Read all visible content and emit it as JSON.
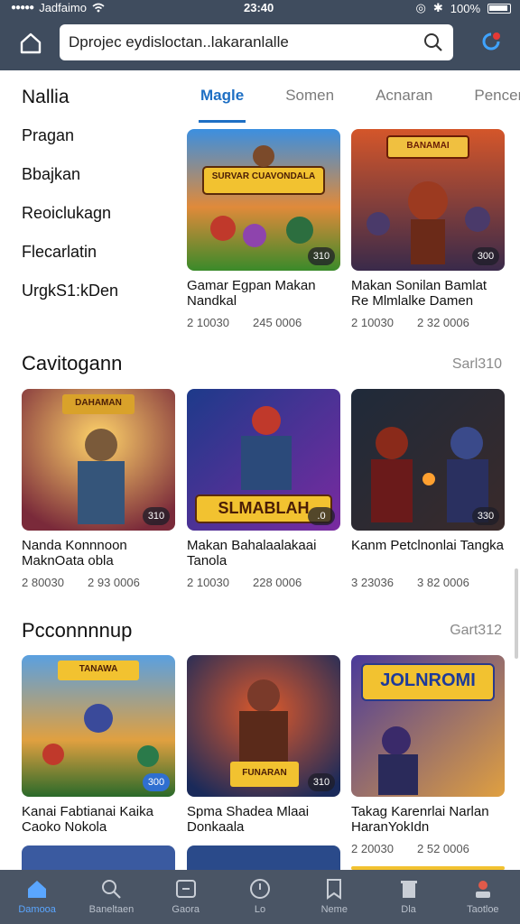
{
  "status_bar": {
    "carrier": "Jadfaimo",
    "time": "23:40",
    "battery": "100%"
  },
  "search": {
    "value": "Dprojec eydisloctan..lakaranlalle"
  },
  "left_menu": {
    "title": "Nallia",
    "items": [
      "Pragan",
      "Bbajkan",
      "Reoiclukagn",
      "Flecarlatin",
      "UrgkS1:kDen"
    ]
  },
  "tabs": [
    {
      "label": "Magle",
      "active": true
    },
    {
      "label": "Somen",
      "active": false
    },
    {
      "label": "Acnaran",
      "active": false
    },
    {
      "label": "Pencen",
      "active": false
    }
  ],
  "featured": [
    {
      "title": "Gamar Egpan Makan Nandkal",
      "badge": "310",
      "views": "2 10030",
      "plays": "245 0006",
      "banner": "SURVAR CUAVONDALA"
    },
    {
      "title": "Makan Sonilan Bamlat Re Mlmlalke Damen",
      "badge": "300",
      "views": "2 10030",
      "plays": "2 32 0006",
      "banner": "BANAMAI"
    }
  ],
  "sections": [
    {
      "title": "Cavitogann",
      "link": "Sarl310",
      "cards": [
        {
          "title": "Nanda Konnnoon MaknOata obla",
          "badge": "310",
          "views": "2 80030",
          "plays": "2 93 0006",
          "banner": "DAHAMAN"
        },
        {
          "title": "Makan Bahalaalakaai Tanola",
          "badge": ".0",
          "views": "2 10030",
          "plays": "228 0006",
          "banner": "SLMABLAH"
        },
        {
          "title": "Kanm Petclnonlai Tangka",
          "badge": "330",
          "views": "3 23036",
          "plays": "3 82 0006",
          "banner": ""
        }
      ]
    },
    {
      "title": "Pcconnnnup",
      "link": "Gart312",
      "cards": [
        {
          "title": "Kanai Fabtianai Kaika Caoko Nokola",
          "badge": "300",
          "views": "",
          "plays": "",
          "banner": "TANAWA"
        },
        {
          "title": "Spma Shadea Mlaai Donkaala",
          "badge": "310",
          "views": "",
          "plays": "",
          "banner": "FUNARAN"
        },
        {
          "title": "Takag Karenrlai Narlan HaranYokIdn",
          "badge": "",
          "views": "2 20030",
          "plays": "2 52 0006",
          "banner": "JOLNROMI"
        }
      ]
    }
  ],
  "bottom_nav": [
    {
      "label": "Damooa",
      "icon": "home-icon",
      "active": true
    },
    {
      "label": "Baneltaen",
      "icon": "search-icon",
      "active": false
    },
    {
      "label": "Gaora",
      "icon": "gamepad-icon",
      "active": false
    },
    {
      "label": "Lo",
      "icon": "clock-icon",
      "active": false
    },
    {
      "label": "Neme",
      "icon": "bookmark-icon",
      "active": false
    },
    {
      "label": "Dla",
      "icon": "trash-icon",
      "active": false
    },
    {
      "label": "Taotloe",
      "icon": "profile-icon",
      "active": false
    }
  ],
  "colors": {
    "header": "#3f4c5e",
    "accent": "#1e6fc4",
    "bottom_nav": "#4a5565"
  }
}
